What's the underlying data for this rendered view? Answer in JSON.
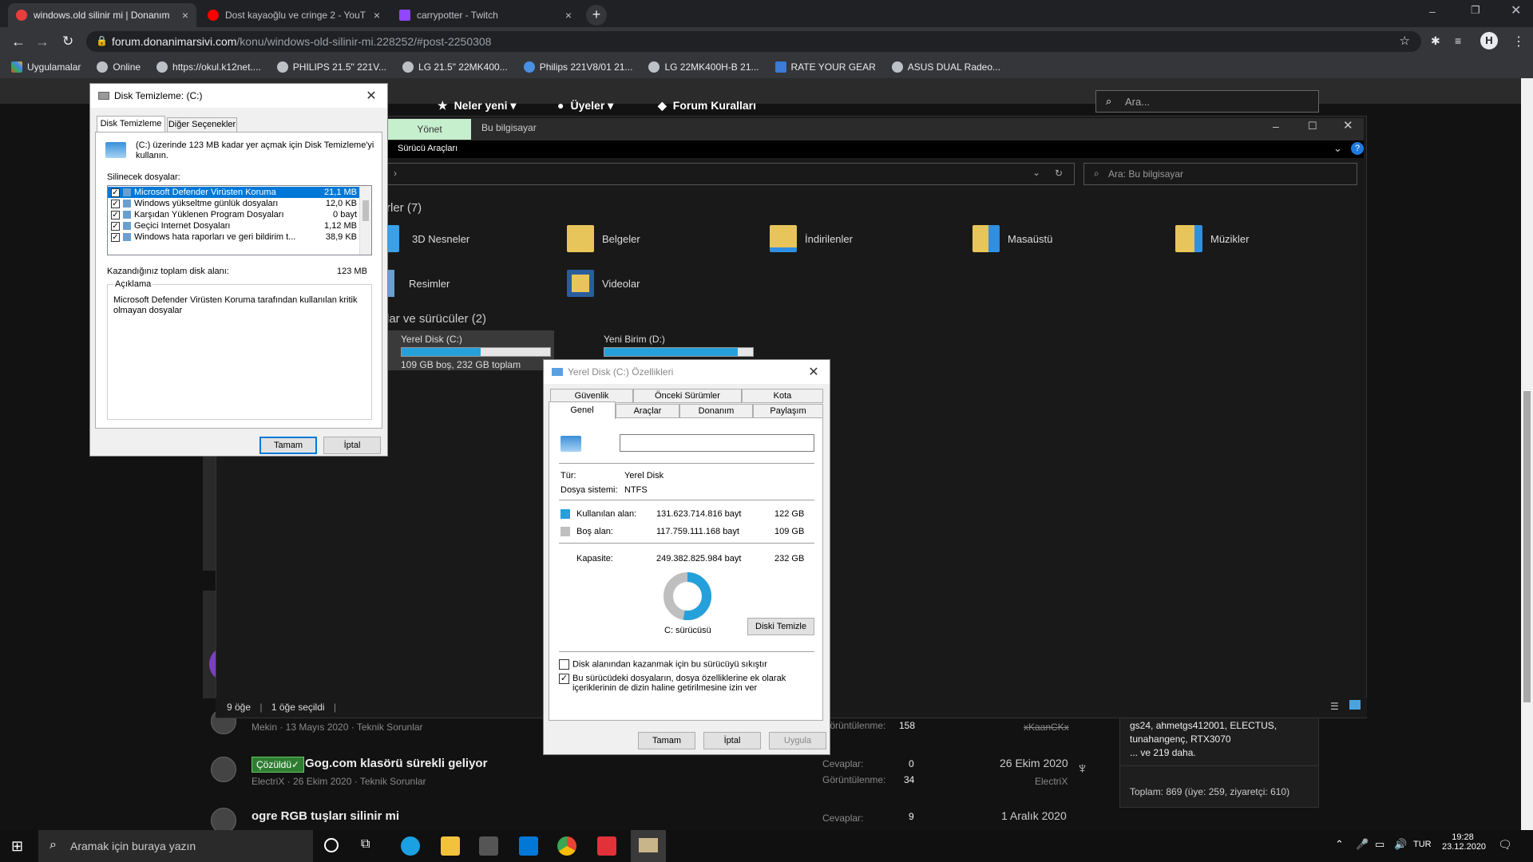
{
  "browser": {
    "tabs": [
      {
        "title": "windows.old silinir mi | Donanım",
        "active": true,
        "favicon_color": "#e83e3e"
      },
      {
        "title": "Dost kayaoğlu ve cringe 2 - YouT",
        "active": false,
        "favicon_color": "#ff0000"
      },
      {
        "title": "carrypotter - Twitch",
        "active": false,
        "favicon_color": "#9146ff"
      }
    ],
    "new_tab": "+",
    "url_host": "forum.donanimarsivi.com",
    "url_path": "/konu/windows-old-silinir-mi.228252/#post-2250308",
    "profile_initial": "H",
    "bookmarks": [
      "Uygulamalar",
      "Online",
      "https://okul.k12net....",
      "PHILIPS 21.5\" 221V...",
      "LG 21.5\" 22MK400...",
      "Philips 221V8/01 21...",
      "LG 22MK400H-B 21...",
      "RATE YOUR GEAR",
      "ASUS DUAL Radeo..."
    ]
  },
  "site": {
    "nav": [
      "Neler yeni",
      "Üyeler",
      "Forum Kuralları"
    ],
    "search_placeholder": "Ara...",
    "threads": [
      {
        "meta": "Mekin · 13 Mayıs 2020 · Teknik Sorunlar",
        "views_label": "Görüntülenme:",
        "views": "158",
        "last_user": "xKaanCKx"
      },
      {
        "badge": "Çözüldü✓",
        "title": "Gog.com klasörü sürekli geliyor",
        "meta": "ElectriX · 26 Ekim 2020 · Teknik Sorunlar",
        "replies_label": "Cevaplar:",
        "replies": "0",
        "views_label": "Görüntülenme:",
        "views": "34",
        "date": "26 Ekim 2020",
        "last_user": "ElectriX"
      },
      {
        "title": "ogre RGB tuşları silinir mi",
        "replies_label": "Cevaplar:",
        "replies": "9",
        "date": "1 Aralık 2020"
      }
    ],
    "online": {
      "names": "gs24, ahmetgs412001, ELECTUS, tunahangenç, RTX3070",
      "more": "... ve 219 daha.",
      "total": "Toplam: 869 (üye: 259, ziyaretçi: 610)"
    }
  },
  "explorer": {
    "ribbon_tab": "Yönet",
    "ribbon_title": "Bu bilgisayar",
    "ribbon_sub": "Sürücü Araçları",
    "search_placeholder": "Ara: Bu bilgisayar",
    "folders_header": "rler (7)",
    "folders": [
      {
        "name": "3D Nesneler",
        "color": "#3aa0e8"
      },
      {
        "name": "Belgeler",
        "color": "#e8c55a"
      },
      {
        "name": "İndirilenler",
        "color": "#e8c55a"
      },
      {
        "name": "Masaüstü",
        "color": "#2f8fe0"
      },
      {
        "name": "Müzikler",
        "color": "#e8c55a"
      },
      {
        "name": "Resimler",
        "color": "#6aa0d0"
      },
      {
        "name": "Videolar",
        "color": "#e8c55a"
      }
    ],
    "drives_header": "lar ve sürücüler (2)",
    "drives": [
      {
        "name": "Yerel Disk (C:)",
        "used_fraction": 0.53,
        "info": "109 GB boş, 232 GB toplam"
      },
      {
        "name": "Yeni Birim (D:)",
        "used_fraction": 0.9,
        "info": ""
      }
    ],
    "status_items": "9 öğe",
    "status_selected": "1 öğe seçildi"
  },
  "disk_cleanup": {
    "title": "Disk Temizleme:  (C:)",
    "tabs": [
      "Disk Temizleme",
      "Diğer Seçenekler"
    ],
    "intro": "(C:) üzerinde 123 MB kadar yer açmak için Disk Temizleme'yi kullanın.",
    "files_label": "Silinecek dosyalar:",
    "files": [
      {
        "name": "Microsoft Defender Virüsten Koruma",
        "size": "21,1 MB",
        "checked": true,
        "selected": true
      },
      {
        "name": "Windows yükseltme günlük dosyaları",
        "size": "12,0 KB",
        "checked": true,
        "selected": false
      },
      {
        "name": "Karşıdan Yüklenen Program Dosyaları",
        "size": "0 bayt",
        "checked": true,
        "selected": false
      },
      {
        "name": "Geçici Internet Dosyaları",
        "size": "1,12 MB",
        "checked": true,
        "selected": false
      },
      {
        "name": "Windows hata raporları ve geri bildirim t...",
        "size": "38,9 KB",
        "checked": true,
        "selected": false
      }
    ],
    "total_label": "Kazandığınız toplam disk alanı:",
    "total_value": "123 MB",
    "desc_label": "Açıklama",
    "desc_text": "Microsoft Defender Virüsten Koruma tarafından kullanılan kritik olmayan dosyalar",
    "ok": "Tamam",
    "cancel": "İptal"
  },
  "properties": {
    "title": "Yerel Disk (C:) Özellikleri",
    "tabs_row1": [
      "Güvenlik",
      "Önceki Sürümler",
      "Kota"
    ],
    "tabs_row2": [
      "Genel",
      "Araçlar",
      "Donanım",
      "Paylaşım"
    ],
    "name_value": "",
    "type_label": "Tür:",
    "type_value": "Yerel Disk",
    "fs_label": "Dosya sistemi:",
    "fs_value": "NTFS",
    "used_label": "Kullanılan alan:",
    "used_bytes": "131.623.714.816 bayt",
    "used_gb": "122 GB",
    "free_label": "Boş alan:",
    "free_bytes": "117.759.111.168 bayt",
    "free_gb": "109 GB",
    "cap_label": "Kapasite:",
    "cap_bytes": "249.382.825.984 bayt",
    "cap_gb": "232 GB",
    "used_fraction": 0.528,
    "used_color": "#26a0da",
    "free_color": "#bfbfbf",
    "drive_label": "C: sürücüsü",
    "cleanup_btn": "Diski Temizle",
    "compress_label": "Disk alanından kazanmak için bu sürücüyü sıkıştır",
    "compress_checked": false,
    "index_label": "Bu sürücüdeki dosyaların, dosya özelliklerine ek olarak içeriklerinin de dizin haline getirilmesine izin ver",
    "index_checked": true,
    "ok": "Tamam",
    "cancel": "İptal",
    "apply": "Uygula"
  },
  "taskbar": {
    "search_placeholder": "Aramak için buraya yazın",
    "lang": "TUR",
    "time": "19:28",
    "date": "23.12.2020"
  }
}
